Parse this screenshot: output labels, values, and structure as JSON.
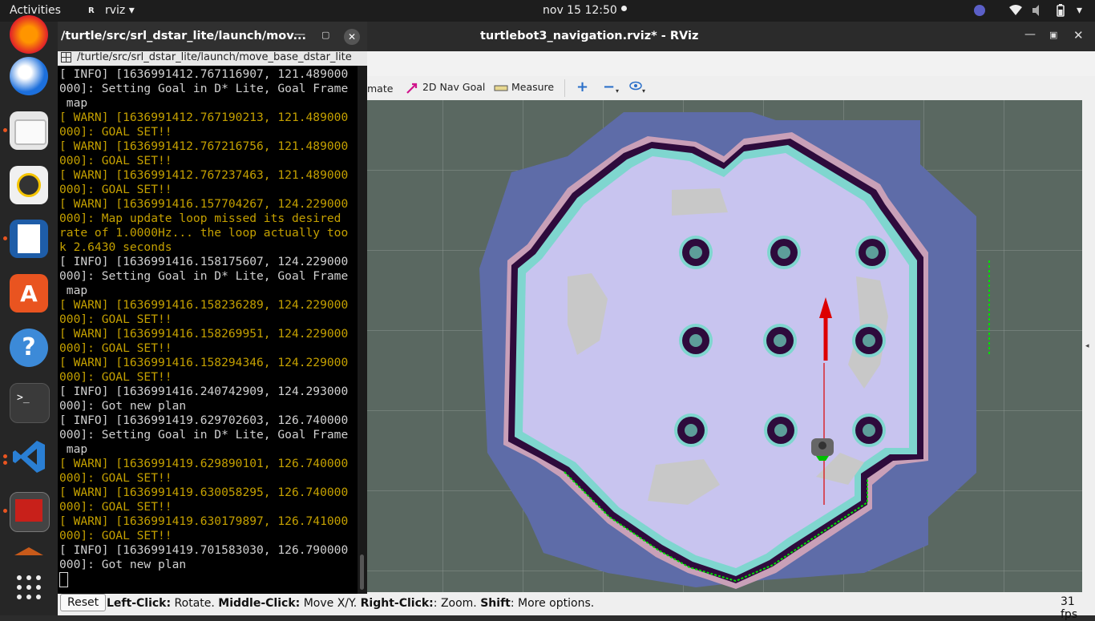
{
  "topbar": {
    "activities": "Activities",
    "app_name": "rviz",
    "clock": "nov 15  12:50"
  },
  "dock": {
    "apps": [
      "firefox-icon",
      "thunderbird-icon",
      "files-icon",
      "rhythmbox-icon",
      "writer-icon",
      "software-icon",
      "help-icon",
      "terminal-icon",
      "vscode-icon",
      "rviz-icon"
    ]
  },
  "rviz": {
    "title": "turtlebot3_navigation.rviz* - RViz",
    "toolbar": {
      "estimate_partial": "mate",
      "nav_goal": "2D Nav Goal",
      "measure": "Measure"
    },
    "status": {
      "reset": "Reset",
      "left_click": "Left-Click:",
      "left_click_desc": " Rotate. ",
      "middle_click": "Middle-Click:",
      "middle_click_desc": " Move X/Y. ",
      "right_click": "Right-Click:",
      "right_click_desc": ": Zoom. ",
      "shift": "Shift",
      "shift_desc": ": More options.",
      "fps": "31 fps"
    }
  },
  "terminal": {
    "title": "/turtle/src/srl_dstar_lite/launch/mov...",
    "tab": "/turtle/src/srl_dstar_lite/launch/move_base_dstar_lite",
    "lines": [
      {
        "level": "info",
        "text": "[ INFO] [1636991412.767116907, 121.489000"
      },
      {
        "level": "info",
        "text": "000]: Setting Goal in D* Lite, Goal Frame"
      },
      {
        "level": "info",
        "text": " map"
      },
      {
        "level": "warn",
        "text": "[ WARN] [1636991412.767190213, 121.489000"
      },
      {
        "level": "warn",
        "text": "000]: GOAL SET!!"
      },
      {
        "level": "warn",
        "text": "[ WARN] [1636991412.767216756, 121.489000"
      },
      {
        "level": "warn",
        "text": "000]: GOAL SET!!"
      },
      {
        "level": "warn",
        "text": "[ WARN] [1636991412.767237463, 121.489000"
      },
      {
        "level": "warn",
        "text": "000]: GOAL SET!!"
      },
      {
        "level": "warn",
        "text": "[ WARN] [1636991416.157704267, 124.229000"
      },
      {
        "level": "warn",
        "text": "000]: Map update loop missed its desired"
      },
      {
        "level": "warn",
        "text": "rate of 1.0000Hz... the loop actually too"
      },
      {
        "level": "warn",
        "text": "k 2.6430 seconds"
      },
      {
        "level": "info",
        "text": "[ INFO] [1636991416.158175607, 124.229000"
      },
      {
        "level": "info",
        "text": "000]: Setting Goal in D* Lite, Goal Frame"
      },
      {
        "level": "info",
        "text": " map"
      },
      {
        "level": "warn",
        "text": "[ WARN] [1636991416.158236289, 124.229000"
      },
      {
        "level": "warn",
        "text": "000]: GOAL SET!!"
      },
      {
        "level": "warn",
        "text": "[ WARN] [1636991416.158269951, 124.229000"
      },
      {
        "level": "warn",
        "text": "000]: GOAL SET!!"
      },
      {
        "level": "warn",
        "text": "[ WARN] [1636991416.158294346, 124.229000"
      },
      {
        "level": "warn",
        "text": "000]: GOAL SET!!"
      },
      {
        "level": "info",
        "text": "[ INFO] [1636991416.240742909, 124.293000"
      },
      {
        "level": "info",
        "text": "000]: Got new plan"
      },
      {
        "level": "info",
        "text": "[ INFO] [1636991419.629702603, 126.740000"
      },
      {
        "level": "info",
        "text": "000]: Setting Goal in D* Lite, Goal Frame"
      },
      {
        "level": "info",
        "text": " map"
      },
      {
        "level": "warn",
        "text": "[ WARN] [1636991419.629890101, 126.740000"
      },
      {
        "level": "warn",
        "text": "000]: GOAL SET!!"
      },
      {
        "level": "warn",
        "text": "[ WARN] [1636991419.630058295, 126.740000"
      },
      {
        "level": "warn",
        "text": "000]: GOAL SET!!"
      },
      {
        "level": "warn",
        "text": "[ WARN] [1636991419.630179897, 126.741000"
      },
      {
        "level": "warn",
        "text": "000]: GOAL SET!!"
      },
      {
        "level": "info",
        "text": "[ INFO] [1636991419.701583030, 126.790000"
      },
      {
        "level": "info",
        "text": "000]: Got new plan"
      }
    ]
  },
  "colors": {
    "info": "#d0d0d0",
    "warn": "#c4a000",
    "costmap_outer": "#5e6ca8",
    "free_space": "#c8c4ef",
    "obstacle": "#2e0b3c",
    "inflation": "#7fd6cf",
    "path": "#00e000",
    "arrow": "#dd0000"
  }
}
